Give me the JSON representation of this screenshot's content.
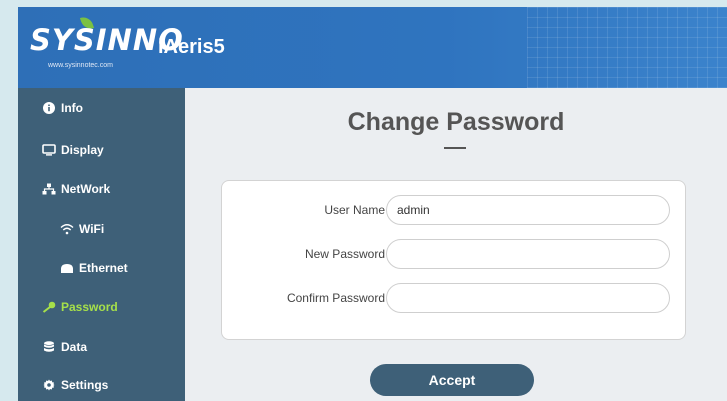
{
  "header": {
    "logo": "SYSINNO",
    "logo_url": "www.sysinnotec.com",
    "product": "iAeris5"
  },
  "sidebar": {
    "items": [
      {
        "label": "Info",
        "icon": "info-icon"
      },
      {
        "label": "Display",
        "icon": "monitor-icon"
      },
      {
        "label": "NetWork",
        "icon": "network-icon"
      },
      {
        "label": "WiFi",
        "icon": "wifi-icon"
      },
      {
        "label": "Ethernet",
        "icon": "ethernet-icon"
      },
      {
        "label": "Password",
        "icon": "key-icon",
        "active": true
      },
      {
        "label": "Data",
        "icon": "database-icon"
      },
      {
        "label": "Settings",
        "icon": "gear-icon"
      }
    ]
  },
  "main": {
    "title": "Change Password",
    "form": {
      "username_label": "User Name",
      "username_value": "admin",
      "new_password_label": "New Password",
      "new_password_value": "",
      "confirm_password_label": "Confirm Password",
      "confirm_password_value": ""
    },
    "accept_label": "Accept"
  },
  "colors": {
    "header": "#2f74bf",
    "sidebar": "#3e6078",
    "active_item": "#a6e04a",
    "background": "#ebeef1"
  }
}
